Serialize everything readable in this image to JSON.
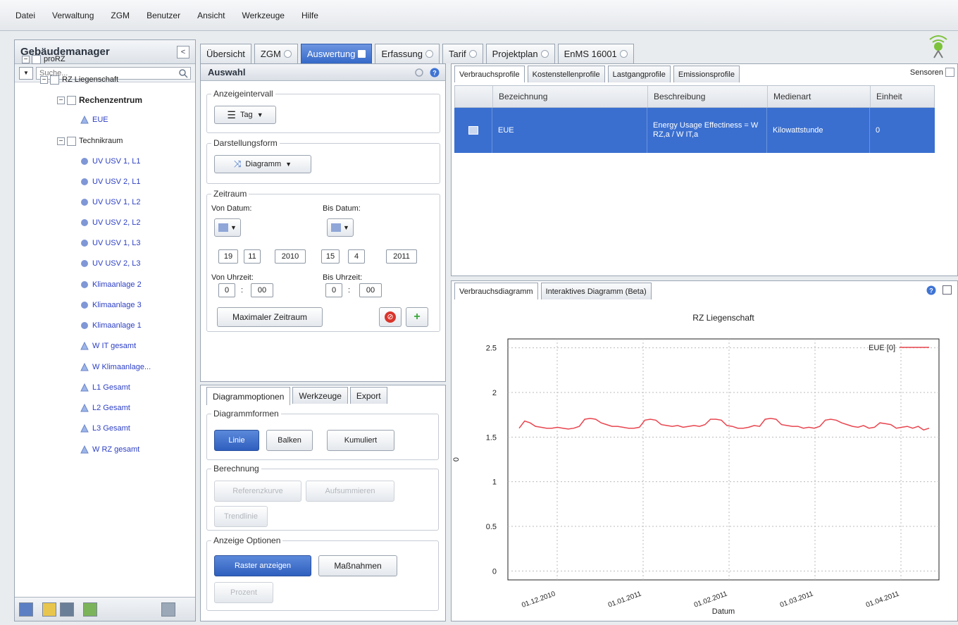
{
  "menu": [
    "Datei",
    "Verwaltung",
    "ZGM",
    "Benutzer",
    "Ansicht",
    "Werkzeuge",
    "Hilfe"
  ],
  "left": {
    "title": "Gebäudemanager",
    "search_placeholder": "Suche...",
    "tree": [
      {
        "label": "proRZ",
        "style": "plain"
      },
      {
        "label": "RZ Liegenschaft",
        "style": "plain"
      },
      {
        "label": "Rechenzentrum",
        "style": "bold"
      },
      {
        "label": "EUE",
        "style": "blue"
      },
      {
        "label": "Technikraum",
        "style": "plain"
      },
      {
        "label": "UV USV 1, L1",
        "style": "blue"
      },
      {
        "label": "UV USV 2, L1",
        "style": "blue"
      },
      {
        "label": "UV USV 1, L2",
        "style": "blue"
      },
      {
        "label": "UV USV 2, L2",
        "style": "blue"
      },
      {
        "label": "UV USV 1, L3",
        "style": "blue"
      },
      {
        "label": "UV USV 2, L3",
        "style": "blue"
      },
      {
        "label": "Klimaanlage 2",
        "style": "blue"
      },
      {
        "label": "Klimaanlage 3",
        "style": "blue"
      },
      {
        "label": "Klimaanlage 1",
        "style": "blue"
      },
      {
        "label": "W IT gesamt",
        "style": "blue"
      },
      {
        "label": "W Klimaanlage...",
        "style": "blue"
      },
      {
        "label": "L1 Gesamt",
        "style": "blue"
      },
      {
        "label": "L2 Gesamt",
        "style": "blue"
      },
      {
        "label": "L3 Gesamt",
        "style": "blue"
      },
      {
        "label": "W RZ gesamt",
        "style": "blue"
      }
    ]
  },
  "tabs": [
    "Übersicht",
    "ZGM",
    "Auswertung",
    "Erfassung",
    "Tarif",
    "Projektplan",
    "EnMS 16001"
  ],
  "auswahl": {
    "title": "Auswahl",
    "anzeigeintervall_label": "Anzeigeintervall",
    "intervall_value": "Tag",
    "darstellungsform_label": "Darstellungsform",
    "darstellung_value": "Diagramm",
    "zeitraum_label": "Zeitraum",
    "von_datum_label": "Von Datum:",
    "bis_datum_label": "Bis Datum:",
    "von_datum": {
      "day": "19",
      "month": "11",
      "year": "2010"
    },
    "bis_datum": {
      "day": "15",
      "month": "4",
      "year": "2011"
    },
    "von_uhrzeit_label": "Von Uhrzeit:",
    "bis_uhrzeit_label": "Bis Uhrzeit:",
    "von_uhrzeit": {
      "h": "0",
      "m": "00"
    },
    "bis_uhrzeit": {
      "h": "0",
      "m": "00"
    },
    "max_zeitraum": "Maximaler Zeitraum"
  },
  "diagopt": {
    "tabs": [
      "Diagrammoptionen",
      "Werkzeuge",
      "Export"
    ],
    "diagrammformen_label": "Diagrammformen",
    "linie": "Linie",
    "balken": "Balken",
    "kumuliert": "Kumuliert",
    "berechnung_label": "Berechnung",
    "referenzkurve": "Referenzkurve",
    "aufsummieren": "Aufsummieren",
    "trendlinie": "Trendlinie",
    "anzeige_label": "Anzeige Optionen",
    "raster": "Raster anzeigen",
    "massnahmen": "Maßnahmen",
    "prozent": "Prozent"
  },
  "profiles": {
    "tabs": [
      "Verbrauchsprofile",
      "Kostenstellenprofile",
      "Lastgangprofile",
      "Emissionsprofile"
    ],
    "sensoren": "Sensoren",
    "headers": [
      "Bezeichnung",
      "Beschreibung",
      "Medienart",
      "Einheit"
    ],
    "row": {
      "bezeichnung": "EUE",
      "beschreibung": "Energy Usage Effectiness = W RZ,a / W IT,a",
      "medienart": "Kilowattstunde",
      "einheit": "0"
    }
  },
  "chartpanel": {
    "tabs": [
      "Verbrauchsdiagramm",
      "Interaktives Diagramm (Beta)"
    ]
  },
  "colors": {
    "accent": "#3a6fd0",
    "line": "#e8454f"
  },
  "chart_data": {
    "type": "line",
    "title": "RZ Liegenschaft",
    "xlabel": "Datum",
    "ylabel": "0",
    "ylim": [
      -0.1,
      2.6
    ],
    "yticks": [
      "2.5",
      "2",
      "1.5",
      "1",
      "0.5",
      "0"
    ],
    "yticks_num": [
      2.5,
      2,
      1.5,
      1,
      0.5,
      0
    ],
    "xticks": [
      "01.12.2010",
      "01.01.2011",
      "01.02.2011",
      "01.03.2011",
      "01.04.2011"
    ],
    "grid": true,
    "legend_position": "top-right",
    "series": [
      {
        "name": "EUE [0]",
        "x_start": "19.11.2010",
        "x_end": "15.04.2011",
        "values": [
          1.6,
          1.68,
          1.66,
          1.62,
          1.61,
          1.6,
          1.6,
          1.61,
          1.6,
          1.59,
          1.6,
          1.62,
          1.7,
          1.71,
          1.7,
          1.66,
          1.64,
          1.62,
          1.62,
          1.61,
          1.6,
          1.6,
          1.61,
          1.69,
          1.7,
          1.69,
          1.64,
          1.63,
          1.62,
          1.63,
          1.61,
          1.62,
          1.63,
          1.62,
          1.64,
          1.7,
          1.7,
          1.69,
          1.63,
          1.62,
          1.6,
          1.6,
          1.61,
          1.63,
          1.62,
          1.7,
          1.71,
          1.7,
          1.64,
          1.63,
          1.62,
          1.62,
          1.6,
          1.61,
          1.6,
          1.62,
          1.69,
          1.7,
          1.69,
          1.66,
          1.64,
          1.62,
          1.61,
          1.63,
          1.6,
          1.61,
          1.66,
          1.65,
          1.64,
          1.6,
          1.61,
          1.62,
          1.6,
          1.62,
          1.58,
          1.6
        ]
      }
    ]
  }
}
